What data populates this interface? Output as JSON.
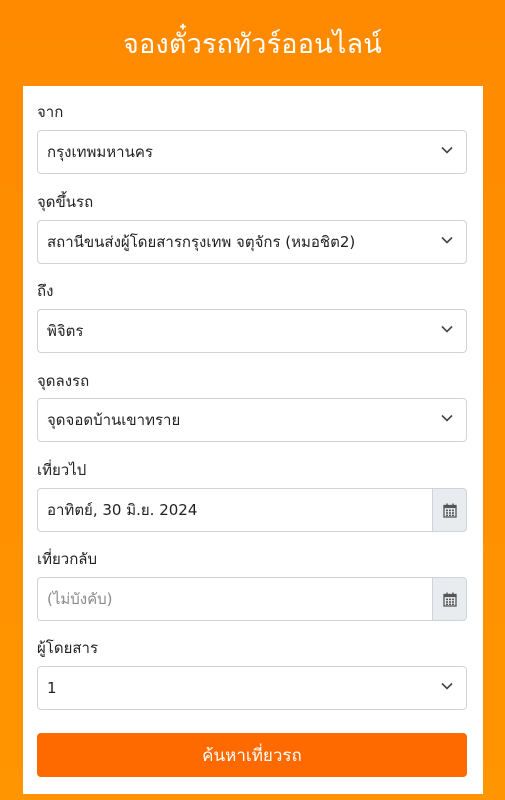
{
  "header": {
    "title": "จองตั๋วรถทัวร์ออนไลน์"
  },
  "form": {
    "origin": {
      "label": "จาก",
      "value": "กรุงเทพมหานคร"
    },
    "boarding_point": {
      "label": "จุดขึ้นรถ",
      "value": "สถานีขนส่งผู้โดยสารกรุงเทพ จตุจักร (หมอชิต2)"
    },
    "destination": {
      "label": "ถึง",
      "value": "พิจิตร"
    },
    "dropoff_point": {
      "label": "จุดลงรถ",
      "value": "จุดจอดบ้านเขาทราย"
    },
    "depart_date": {
      "label": "เที่ยวไป",
      "value": "อาทิตย์, 30 มิ.ย. 2024"
    },
    "return_date": {
      "label": "เที่ยวกลับ",
      "placeholder": "(ไม่บังคับ)"
    },
    "passengers": {
      "label": "ผู้โดยสาร",
      "value": "1"
    },
    "submit_label": "ค้นหาเที่ยวรถ"
  },
  "colors": {
    "background": "#ff8a00",
    "button": "#ff6a00",
    "card": "#ffffff"
  },
  "icons": {
    "select_arrow": "chevron-down-icon",
    "date_picker": "calendar-icon"
  }
}
